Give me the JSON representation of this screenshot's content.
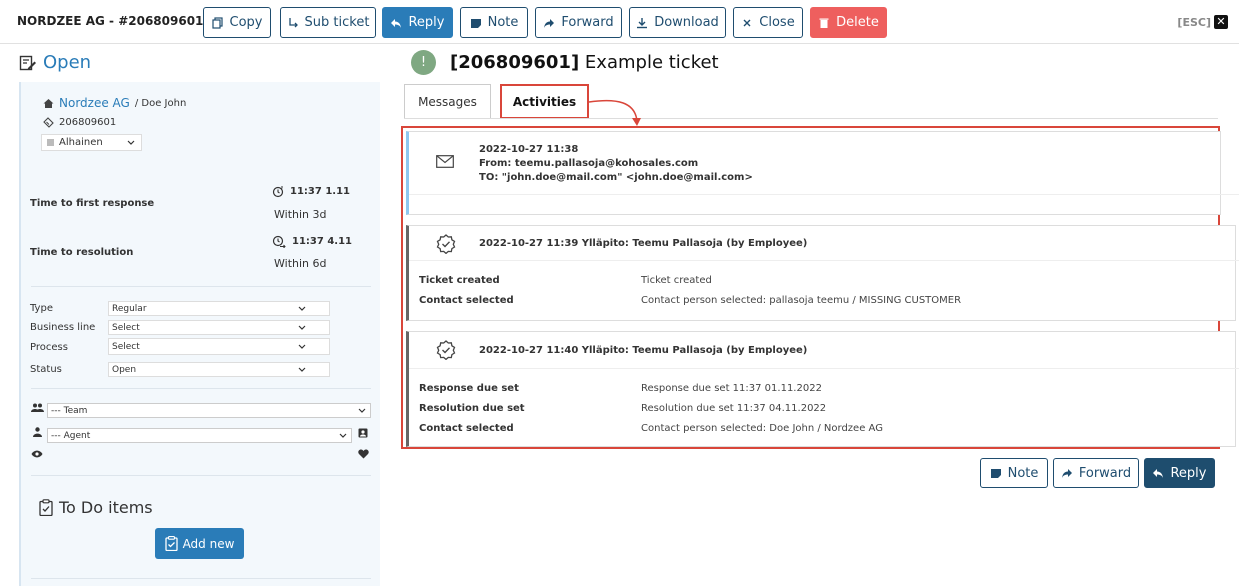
{
  "header": {
    "title": "NORDZEE AG - #206809601",
    "esc": "[ESC]",
    "close_x": "✕"
  },
  "toolbar": {
    "copy": "Copy",
    "sub_ticket": "Sub ticket",
    "reply": "Reply",
    "note": "Note",
    "forward": "Forward",
    "download": "Download",
    "close": "Close",
    "delete": "Delete"
  },
  "status": {
    "label": "Open"
  },
  "sidebar": {
    "company": "Nordzee AG",
    "contact": "/ Doe John",
    "ticket_number": "206809601",
    "priority": "Alhainen",
    "time_first_label": "Time to first response",
    "time_first_value": "11:37 1.11",
    "time_first_sub": "Within 3d",
    "time_res_label": "Time to resolution",
    "time_res_value": "11:37 4.11",
    "time_res_sub": "Within 6d",
    "fields": [
      {
        "label": "Type",
        "value": "Regular"
      },
      {
        "label": "Business line",
        "value": "Select"
      },
      {
        "label": "Process",
        "value": "Select"
      },
      {
        "label": "Status",
        "value": "Open"
      }
    ],
    "team": "--- Team",
    "agent": "--- Agent",
    "todo_title": "To Do items",
    "add_new": "Add new"
  },
  "ticket": {
    "id": "[206809601]",
    "title": "Example ticket"
  },
  "tabs": {
    "messages": "Messages",
    "activities": "Activities"
  },
  "activities": {
    "email": {
      "date": "2022-10-27 11:38",
      "from": "From: teemu.pallasoja@kohosales.com",
      "to": "TO: \"john.doe@mail.com\" <john.doe@mail.com>"
    },
    "entry1": {
      "head": "2022-10-27 11:39 Ylläpito: Teemu Pallasoja (by Employee)",
      "rows": [
        {
          "label": "Ticket created",
          "value": "Ticket created"
        },
        {
          "label": "Contact selected",
          "value": "Contact person selected: pallasoja teemu / MISSING CUSTOMER"
        }
      ]
    },
    "entry2": {
      "head": "2022-10-27 11:40 Ylläpito: Teemu Pallasoja (by Employee)",
      "rows": [
        {
          "label": "Response due set",
          "value": "Response due set 11:37 01.11.2022"
        },
        {
          "label": "Resolution due set",
          "value": "Resolution due set 11:37 04.11.2022"
        },
        {
          "label": "Contact selected",
          "value": "Contact person selected: Doe John / Nordzee AG"
        }
      ]
    }
  },
  "footer": {
    "note": "Note",
    "forward": "Forward",
    "reply": "Reply"
  },
  "colors": {
    "accent": "#2a7cb8",
    "danger": "#ee5f5e",
    "highlight": "#d9463a",
    "dark": "#1e4d6e"
  }
}
